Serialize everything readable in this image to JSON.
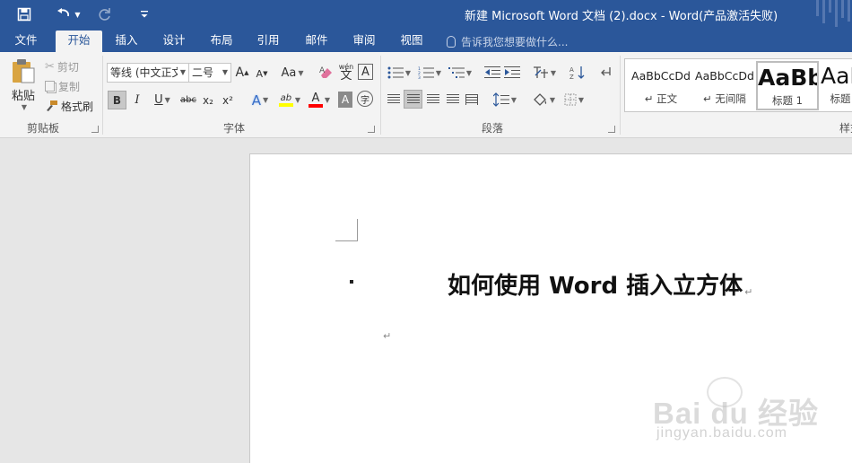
{
  "title_bar": {
    "title": "新建 Microsoft Word 文档 (2).docx - Word(产品激活失败)",
    "quick_access": [
      "save-icon",
      "undo-icon",
      "redo-icon",
      "customize-quick-access-icon"
    ]
  },
  "tabs": [
    "文件",
    "开始",
    "插入",
    "设计",
    "布局",
    "引用",
    "邮件",
    "审阅",
    "视图"
  ],
  "active_tab": "开始",
  "tell_me": "告诉我您想要做什么...",
  "clipboard": {
    "paste": "粘贴",
    "cut": "剪切",
    "copy": "复制",
    "format_painter": "格式刷",
    "label": "剪贴板"
  },
  "font": {
    "name": "等线 (中文正文)",
    "size": "二号",
    "grow": "A",
    "shrink": "A",
    "change_case": "Aa",
    "phonetic": "wén",
    "bold": "B",
    "italic": "I",
    "underline": "U",
    "strike": "abc",
    "subscript": "x₂",
    "superscript": "x²",
    "text_effects": "A",
    "highlight": "ab",
    "font_color": "A",
    "char_shading": "A",
    "enclose": "字",
    "label": "字体"
  },
  "paragraph": {
    "label": "段落"
  },
  "styles": {
    "items": [
      {
        "sample": "AaBbCcDd",
        "name": "正文"
      },
      {
        "sample": "AaBbCcDd",
        "name": "无间隔"
      },
      {
        "sample": "AaBb",
        "name": "标题 1"
      },
      {
        "sample": "AaB",
        "name": "标题"
      }
    ],
    "label": "样式"
  },
  "document": {
    "heading": "如何使用 Word 插入立方体",
    "paragraph_mark": "↵"
  },
  "watermark": {
    "logo": "Bai du 经验",
    "url": "jingyan.baidu.com"
  },
  "colors": {
    "title_bar": "#2b579a",
    "ribbon": "#f3f3f3",
    "canvas": "#e6e6e6",
    "highlight_yellow": "#ffff00",
    "font_red": "#ff0000"
  }
}
